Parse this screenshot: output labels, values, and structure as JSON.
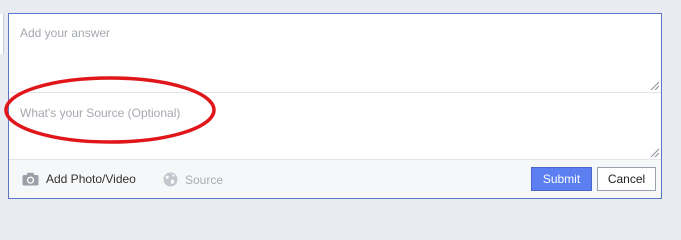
{
  "composer": {
    "answer_placeholder": "Add your answer",
    "source_placeholder": "What's your Source (Optional)"
  },
  "toolbar": {
    "photo_label": "Add Photo/Video",
    "source_label": "Source",
    "submit_label": "Submit",
    "cancel_label": "Cancel"
  },
  "icons": {
    "photo": "camera-icon",
    "source": "globe-icon",
    "resize": "resize-grip-icon"
  },
  "colors": {
    "frame_border": "#5b75c6",
    "submit_bg": "#5b7ff0",
    "annotation": "#e0161b"
  }
}
